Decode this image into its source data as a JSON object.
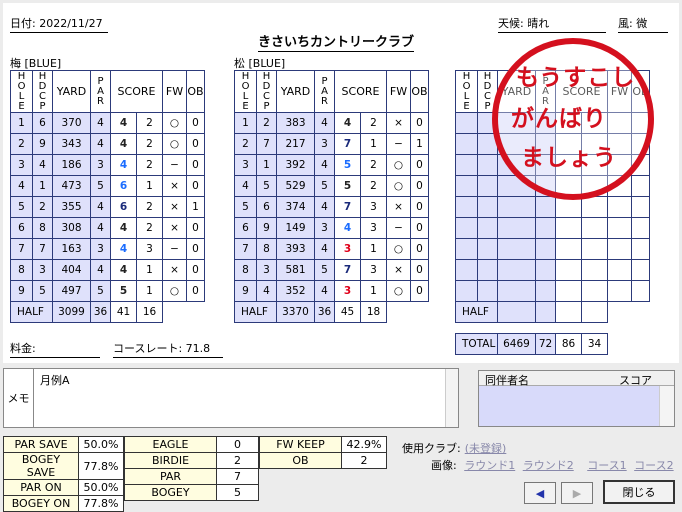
{
  "header": {
    "date": "日付: 2022/11/27",
    "weather": "天候: 晴れ",
    "wind": "風: 微",
    "club": "きさいちカントリークラブ"
  },
  "columns": {
    "hole": "HOLE",
    "hdcp": "HDCP",
    "yard": "YARD",
    "par": "PAR",
    "score": "SCORE",
    "fw": "FW",
    "ob": "OB",
    "half": "HALF",
    "total": "TOTAL"
  },
  "tables": [
    {
      "label": "梅 [BLUE]",
      "rows": [
        [
          "1",
          "6",
          "370",
          "4",
          "4",
          "2",
          "○",
          "0"
        ],
        [
          "2",
          "9",
          "343",
          "4",
          "4",
          "2",
          "○",
          "0"
        ],
        [
          "3",
          "4",
          "186",
          "3",
          "4",
          "2",
          "−",
          "0"
        ],
        [
          "4",
          "1",
          "473",
          "5",
          "6",
          "1",
          "×",
          "0"
        ],
        [
          "5",
          "2",
          "355",
          "4",
          "6",
          "2",
          "×",
          "1"
        ],
        [
          "6",
          "8",
          "308",
          "4",
          "4",
          "2",
          "×",
          "0"
        ],
        [
          "7",
          "7",
          "163",
          "3",
          "4",
          "3",
          "−",
          "0"
        ],
        [
          "8",
          "3",
          "404",
          "4",
          "4",
          "1",
          "×",
          "0"
        ],
        [
          "9",
          "5",
          "497",
          "5",
          "5",
          "1",
          "○",
          "0"
        ]
      ],
      "half": {
        "yard": "3099",
        "par": "36",
        "score": "41",
        "putt": "16"
      }
    },
    {
      "label": "松 [BLUE]",
      "rows": [
        [
          "1",
          "2",
          "383",
          "4",
          "4",
          "2",
          "×",
          "0"
        ],
        [
          "2",
          "7",
          "217",
          "3",
          "7",
          "1",
          "−",
          "1"
        ],
        [
          "3",
          "1",
          "392",
          "4",
          "5",
          "2",
          "○",
          "0"
        ],
        [
          "4",
          "5",
          "529",
          "5",
          "5",
          "2",
          "○",
          "0"
        ],
        [
          "5",
          "6",
          "374",
          "4",
          "7",
          "3",
          "×",
          "0"
        ],
        [
          "6",
          "9",
          "149",
          "3",
          "4",
          "3",
          "−",
          "0"
        ],
        [
          "7",
          "8",
          "393",
          "4",
          "3",
          "1",
          "○",
          "0"
        ],
        [
          "8",
          "3",
          "581",
          "5",
          "7",
          "3",
          "×",
          "0"
        ],
        [
          "9",
          "4",
          "352",
          "4",
          "3",
          "1",
          "○",
          "0"
        ]
      ],
      "half": {
        "yard": "3370",
        "par": "36",
        "score": "45",
        "putt": "18"
      }
    }
  ],
  "total": {
    "yard": "6469",
    "par": "72",
    "score": "86",
    "putt": "34"
  },
  "stamp": {
    "line1": "もうすこし",
    "line2": "がんばり",
    "line3": "ましょう"
  },
  "fee": "料金:",
  "course_rate_label": "コースレート:",
  "course_rate": "71.8",
  "memo": {
    "label": "メモ",
    "text": "月例A"
  },
  "companions": {
    "name_header": "同伴者名",
    "score_header": "スコア"
  },
  "stats": {
    "col1": [
      [
        "PAR SAVE",
        "50.0%"
      ],
      [
        "BOGEY SAVE",
        "77.8%"
      ],
      [
        "PAR ON",
        "50.0%"
      ],
      [
        "BOGEY ON",
        "77.8%"
      ]
    ],
    "col2": [
      [
        "EAGLE",
        "0"
      ],
      [
        "BIRDIE",
        "2"
      ],
      [
        "PAR",
        "7"
      ],
      [
        "BOGEY",
        "5"
      ]
    ],
    "col3": [
      [
        "FW KEEP",
        "42.9%"
      ],
      [
        "OB",
        "2"
      ]
    ]
  },
  "clubs": {
    "label": "使用クラブ:",
    "value": "(未登録)"
  },
  "images": {
    "label": "画像:",
    "items": [
      "ラウンド1",
      "ラウンド2",
      "コース1",
      "コース2"
    ]
  },
  "buttons": {
    "back": "◀",
    "forward": "▶",
    "close": "閉じる"
  },
  "colors": {
    "grid": "#2c3a7a",
    "lavender": "#dfe1fb",
    "stamp": "#d4101e",
    "birdie": "#e0001a",
    "bogey": "#1a6cff",
    "double": "#1a2a7a"
  }
}
